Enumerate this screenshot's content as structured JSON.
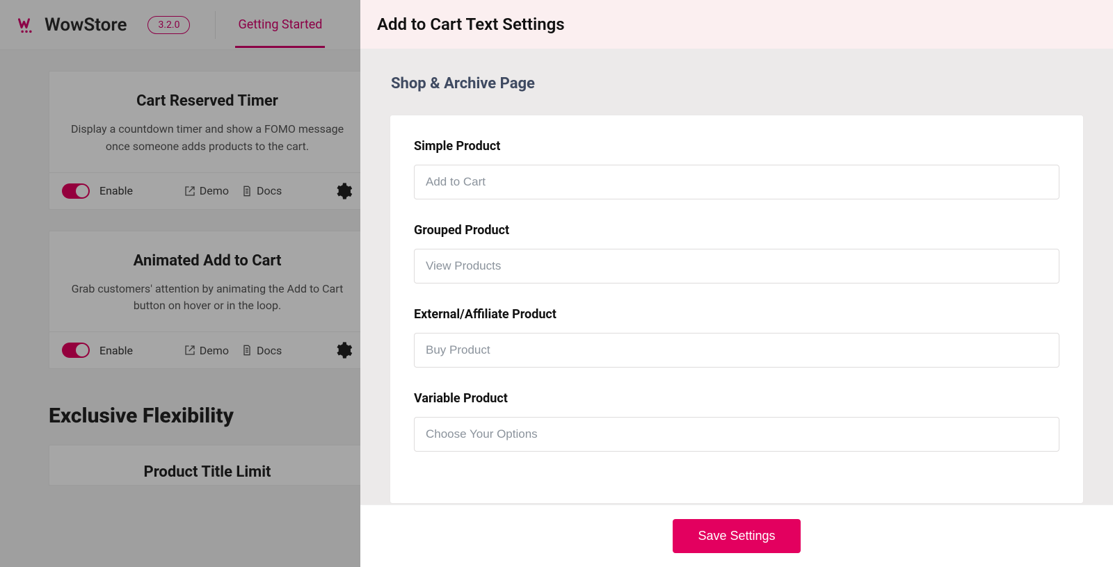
{
  "header": {
    "brand": "WowStore",
    "version": "3.2.0",
    "active_tab": "Getting Started"
  },
  "cards": [
    {
      "title": "Cart Reserved Timer",
      "desc": "Display a countdown timer and show a FOMO message once someone adds products to the cart.",
      "enable_label": "Enable",
      "demo_label": "Demo",
      "docs_label": "Docs",
      "enabled": true
    },
    {
      "title": "Animated Add to Cart",
      "desc": "Grab customers' attention by animating the Add to Cart button on hover or in the loop.",
      "enable_label": "Enable",
      "demo_label": "Demo",
      "docs_label": "Docs",
      "enabled": true
    }
  ],
  "section_title": "Exclusive Flexibility",
  "card3": {
    "title": "Product Title Limit"
  },
  "panel": {
    "title": "Add to Cart Text Settings",
    "section": "Shop & Archive Page",
    "fields": [
      {
        "label": "Simple Product",
        "placeholder": "Add to Cart",
        "value": ""
      },
      {
        "label": "Grouped Product",
        "placeholder": "View Products",
        "value": ""
      },
      {
        "label": "External/Affiliate Product",
        "placeholder": "Buy Product",
        "value": ""
      },
      {
        "label": "Variable Product",
        "placeholder": "Choose Your Options",
        "value": ""
      }
    ],
    "save_label": "Save Settings"
  }
}
